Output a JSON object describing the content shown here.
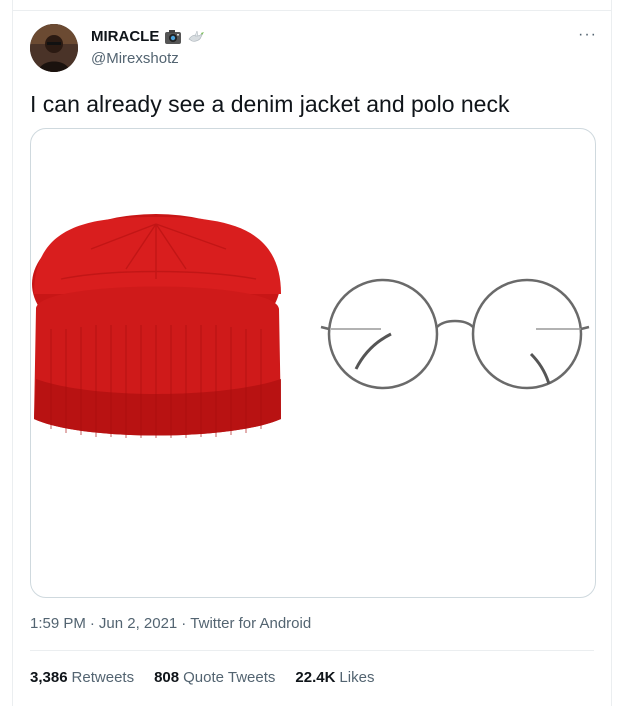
{
  "tweet": {
    "author": {
      "name": "MIRACLE",
      "handle": "@Mirexshotz",
      "emojis": [
        "camera-emoji",
        "dove-emoji"
      ]
    },
    "more_label": "···",
    "text": "I can already see a denim jacket and polo neck",
    "media": {
      "items": [
        "red-beanie-image",
        "round-glasses-image"
      ]
    },
    "time": "1:59 PM",
    "separator": "·",
    "date": "Jun 2, 2021",
    "source": "Twitter for Android",
    "stats": {
      "retweets_count": "3,386",
      "retweets_label": "Retweets",
      "quote_count": "808",
      "quote_label": "Quote Tweets",
      "likes_count": "22.4K",
      "likes_label": "Likes"
    }
  },
  "colors": {
    "text": "#0f1419",
    "secondary": "#536471",
    "border": "#cfd9de",
    "beanie": "#d91e1e"
  }
}
